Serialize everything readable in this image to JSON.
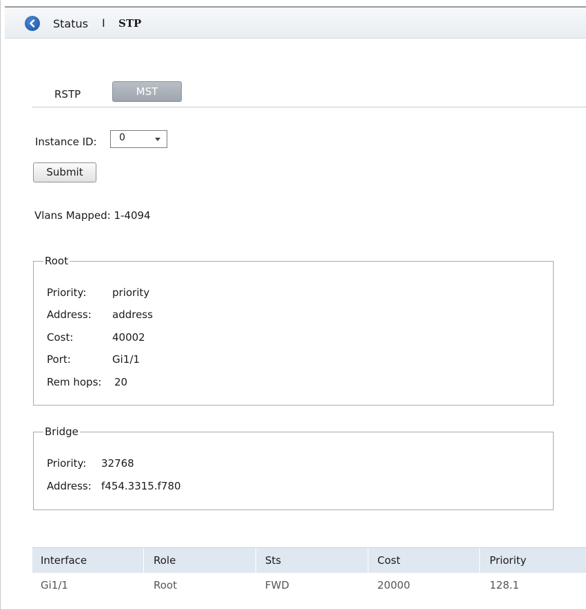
{
  "header": {
    "back_icon": "back-arrow-icon",
    "breadcrumb_parent": "Status",
    "breadcrumb_separator": "I",
    "breadcrumb_current": "STP"
  },
  "tabs": [
    {
      "label": "RSTP",
      "active": false
    },
    {
      "label": "MST",
      "active": true
    }
  ],
  "instance": {
    "label": "Instance ID:",
    "selected": "0"
  },
  "submit_label": "Submit",
  "vlans_mapped": "Vlans Mapped: 1-4094",
  "root": {
    "legend": "Root",
    "rows": [
      {
        "key": "Priority:",
        "value": "priority"
      },
      {
        "key": "Address:",
        "value": "address"
      },
      {
        "key": "Cost:",
        "value": "40002"
      },
      {
        "key": "Port:",
        "value": "Gi1/1"
      },
      {
        "key": "Rem hops:",
        "value": "20"
      }
    ]
  },
  "bridge": {
    "legend": "Bridge",
    "rows": [
      {
        "key": "Priority:",
        "value": "32768"
      },
      {
        "key": "Address:",
        "value": "f454.3315.f780"
      }
    ]
  },
  "table": {
    "headers": [
      "Interface",
      "Role",
      "Sts",
      "Cost",
      "Priority"
    ],
    "rows": [
      [
        "Gi1/1",
        "Root",
        "FWD",
        "20000",
        "128.1"
      ]
    ]
  },
  "colors": {
    "accent": "#1a4f99",
    "tab_active": "#a8aeb6",
    "table_header": "#dfe8f1"
  }
}
